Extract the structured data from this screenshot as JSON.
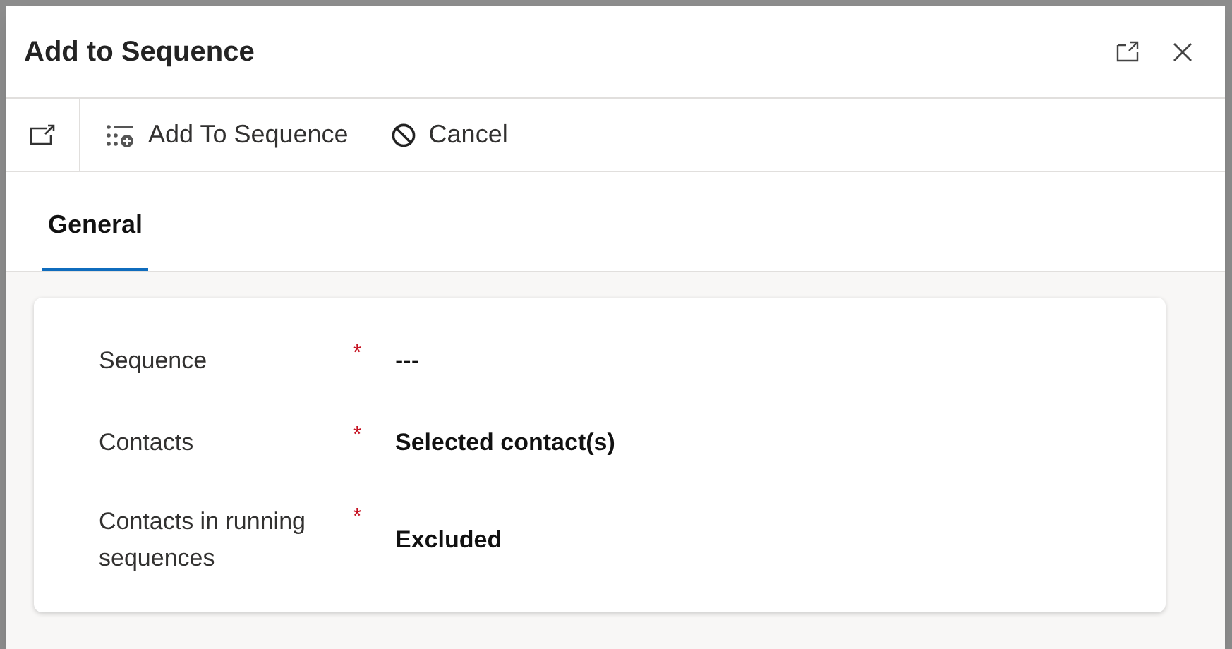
{
  "window": {
    "title": "Add to Sequence"
  },
  "toolbar": [
    {
      "kind": "popout"
    },
    {
      "kind": "add",
      "label": "Add To Sequence"
    },
    {
      "kind": "cancel",
      "label": "Cancel"
    }
  ],
  "tabs": [
    {
      "label": "General",
      "selected": true
    }
  ],
  "fields": [
    {
      "label": "Sequence",
      "required_mark": "*",
      "value": "---",
      "empty": true
    },
    {
      "label": "Contacts",
      "required_mark": "*",
      "value": "Selected contact(s)",
      "empty": false
    },
    {
      "label": "Contacts in running sequences",
      "required_mark": "*",
      "value": "Excluded",
      "empty": false
    }
  ]
}
